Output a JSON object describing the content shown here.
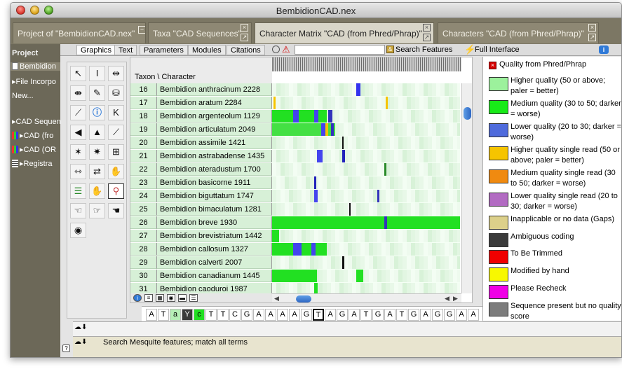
{
  "window": {
    "title": "BembidionCAD.nex"
  },
  "tabs": [
    {
      "label": "Project of \"BembidionCAD.nex\""
    },
    {
      "label": "Taxa \"CAD Sequences\""
    },
    {
      "label": "Character Matrix \"CAD (from Phred/Phrap)\""
    },
    {
      "label": "Characters \"CAD (from Phred/Phrap)\""
    }
  ],
  "project_panel": {
    "items": [
      {
        "label": "Project",
        "icon": "project-heading"
      },
      {
        "label": "Bembidion",
        "icon": "document-icon"
      },
      {
        "label": "File Incorpo",
        "icon": "triangle-icon"
      },
      {
        "label": "New...",
        "icon": ""
      },
      {
        "label": "CAD Sequen",
        "icon": "triangle-icon"
      },
      {
        "label": "CAD (fro",
        "icon": "matrix-icon"
      },
      {
        "label": "CAD (OR",
        "icon": "matrix-icon"
      },
      {
        "label": "Registra",
        "icon": "registration-icon"
      }
    ]
  },
  "subtabs": [
    "Graphics",
    "Text",
    "Parameters",
    "Modules",
    "Citations"
  ],
  "toolbar": {
    "search_placeholder": "",
    "search_label": "Search Features",
    "full_interface_label": "Full Interface"
  },
  "matrix": {
    "corner_label": "Taxon  \\  Character",
    "rows": [
      {
        "num": "16",
        "name": "Bembidion anthracinum 2228"
      },
      {
        "num": "17",
        "name": "Bembidion aratum 2284"
      },
      {
        "num": "18",
        "name": "Bembidion argenteolum 1129"
      },
      {
        "num": "19",
        "name": "Bembidion articulatum 2049"
      },
      {
        "num": "20",
        "name": "Bembidion assimile 1421"
      },
      {
        "num": "21",
        "name": "Bembidion astrabadense 1435"
      },
      {
        "num": "22",
        "name": "Bembidion ateradustum 1700"
      },
      {
        "num": "23",
        "name": "Bembidion basicorne 1911"
      },
      {
        "num": "24",
        "name": "Bembidion biguttatum 1747"
      },
      {
        "num": "25",
        "name": "Bembidion bimaculatum 1281"
      },
      {
        "num": "26",
        "name": "Bembidion breve 1930"
      },
      {
        "num": "27",
        "name": "Bembidion brevistriatum 1442"
      },
      {
        "num": "28",
        "name": "Bembidion callosum 1327"
      },
      {
        "num": "29",
        "name": "Bembidion calverti 2007"
      },
      {
        "num": "30",
        "name": "Bembidion canadianum 1445"
      },
      {
        "num": "31",
        "name": "Bembidion caoduroi 1987"
      }
    ]
  },
  "sequence": [
    "A",
    "T",
    "a",
    "Y",
    "c",
    "T",
    "T",
    "C",
    "G",
    "A",
    "A",
    "A",
    "A",
    "G",
    "T",
    "A",
    "G",
    "A",
    "T",
    "G",
    "A",
    "T",
    "G",
    "A",
    "G",
    "G",
    "A",
    "A"
  ],
  "legend": {
    "title": "Quality from Phred/Phrap",
    "items": [
      {
        "label": "Higher quality (50 or above; paler = better)",
        "color": "#9cf19c"
      },
      {
        "label": "Medium quality (30 to 50; darker = worse)",
        "color": "#18ea18"
      },
      {
        "label": "Lower quality (20 to 30; darker = worse)",
        "color": "#4f6bdc"
      },
      {
        "label": "Higher quality single read (50 or above; paler = better)",
        "color": "#f6c400"
      },
      {
        "label": "Medium quality single read (30 to 50; darker = worse)",
        "color": "#f08a10"
      },
      {
        "label": "Lower quality single read (20 to 30; darker = worse)",
        "color": "#b26bc2"
      },
      {
        "label": "Inapplicable or no data (Gaps)",
        "color": "#dcd08a"
      },
      {
        "label": "Ambiguous coding",
        "color": "#3b3b3b"
      },
      {
        "label": "To Be Trimmed",
        "color": "#f00000"
      },
      {
        "label": "Modified by hand",
        "color": "#f8f800"
      },
      {
        "label": "Please Recheck",
        "color": "#f000e6"
      },
      {
        "label": "Sequence present but no quality score",
        "color": "#7c7c7c"
      }
    ]
  },
  "status": {
    "text": "Search Mesquite features; match all terms"
  },
  "colors": {
    "tabbar": "#7c7764",
    "cell_pale": "#eaf8ea",
    "row_header": "#d7f0d7"
  }
}
